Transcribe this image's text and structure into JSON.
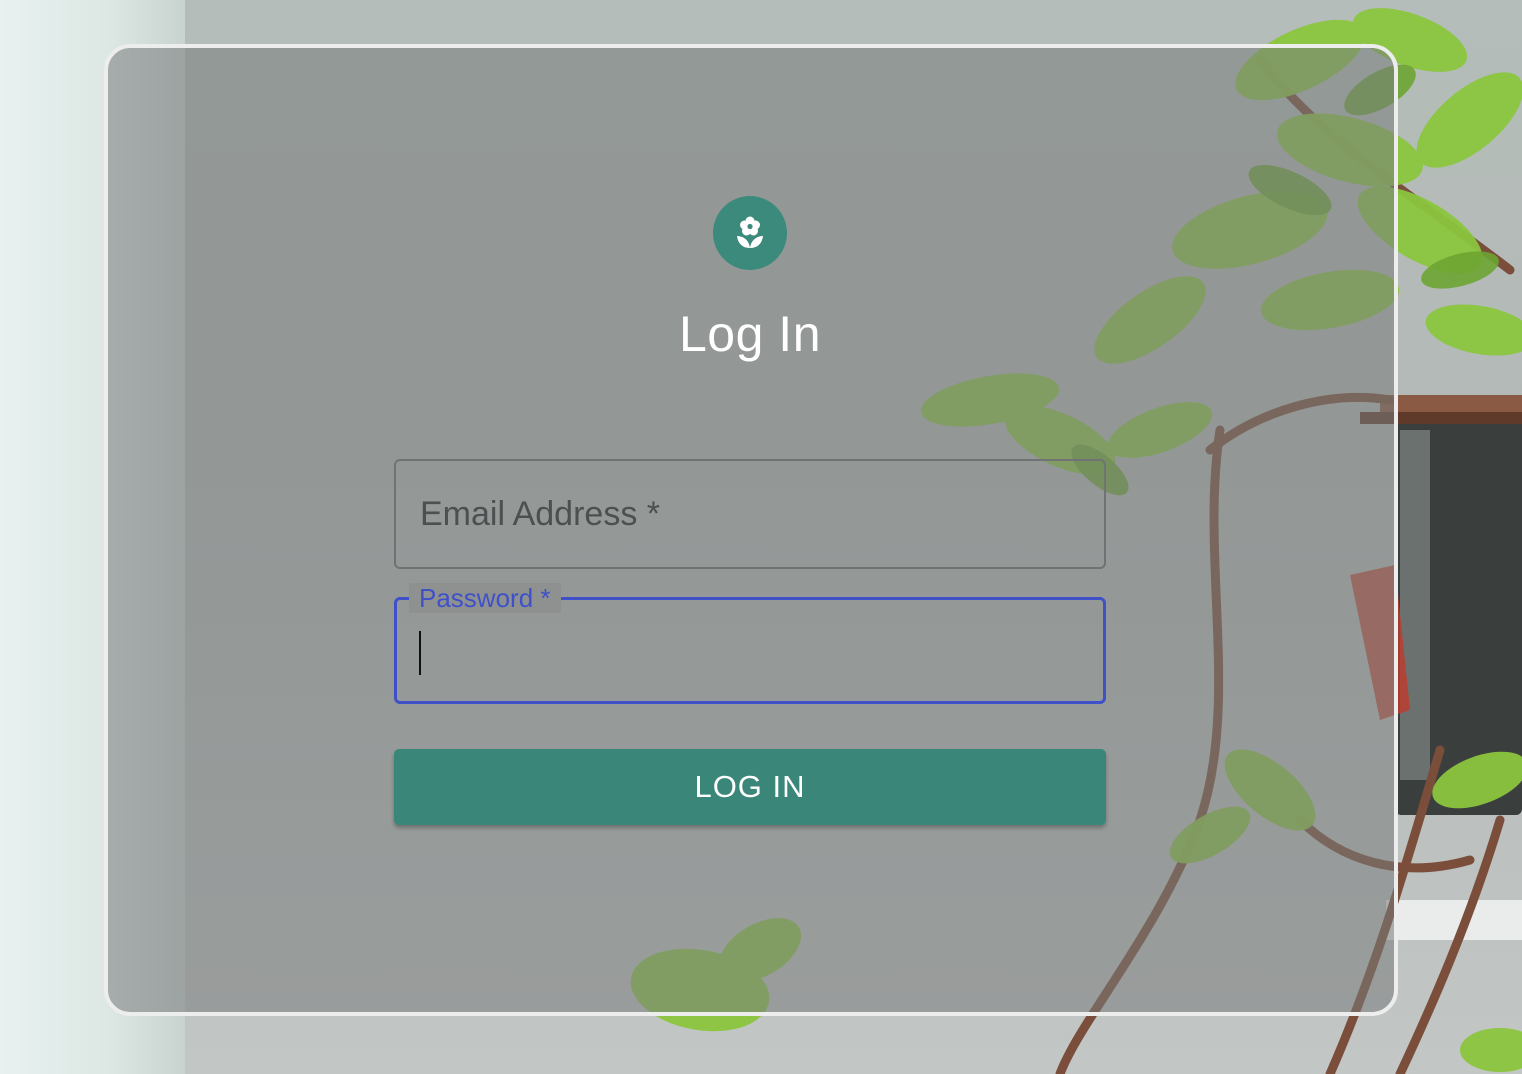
{
  "page": {
    "title": "Log In",
    "logo_icon": "flower-seedling-icon"
  },
  "form": {
    "email_label": "Email Address",
    "email_required_marker": "*",
    "email_value": "",
    "password_label": "Password",
    "password_required_marker": "*",
    "password_value": "",
    "submit_label": "LOG IN"
  },
  "colors": {
    "accent": "#3b8a7b",
    "focus": "#3f51c9",
    "text_on_accent": "#ffffff"
  }
}
